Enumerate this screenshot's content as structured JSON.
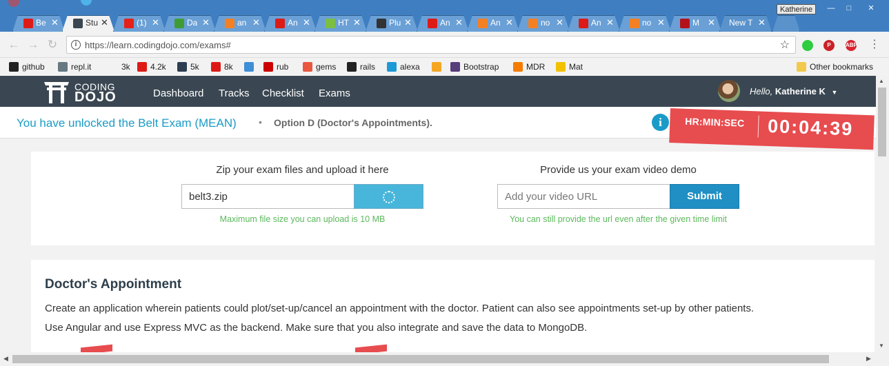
{
  "window": {
    "user": "Katherine",
    "tabs": [
      {
        "label": "Be",
        "icon": "angular-icon",
        "color": "#dd1b16"
      },
      {
        "label": "Stu",
        "icon": "codingdojo-icon",
        "color": "#3a4752"
      },
      {
        "label": "(1)",
        "icon": "youtube-icon",
        "color": "#e62117"
      },
      {
        "label": "Da",
        "icon": "mongodb-icon",
        "color": "#3f9c35"
      },
      {
        "label": "an",
        "icon": "stackoverflow-icon",
        "color": "#f48024"
      },
      {
        "label": "An",
        "icon": "angular-icon",
        "color": "#dd1b16"
      },
      {
        "label": "HT",
        "icon": "chart-icon",
        "color": "#7bbf42"
      },
      {
        "label": "Plu",
        "icon": "plunker-icon",
        "color": "#333333"
      },
      {
        "label": "An",
        "icon": "angular-icon",
        "color": "#dd1b16"
      },
      {
        "label": "An",
        "icon": "stackoverflow-icon",
        "color": "#f48024"
      },
      {
        "label": "no",
        "icon": "stackoverflow-icon",
        "color": "#f48024"
      },
      {
        "label": "An",
        "icon": "angular-icon",
        "color": "#dd1b16"
      },
      {
        "label": "no",
        "icon": "stackoverflow-icon",
        "color": "#f48024"
      },
      {
        "label": "M",
        "icon": "mdn-icon",
        "color": "#b4121a"
      },
      {
        "label": "New T",
        "icon": "",
        "color": ""
      }
    ]
  },
  "toolbar": {
    "url": "https://learn.codingdojo.com/exams#",
    "extensions": [
      {
        "name": "green-dot-icon",
        "color": "#2ecc40",
        "text": ""
      },
      {
        "name": "pinterest-icon",
        "color": "#cb2027",
        "text": "P"
      },
      {
        "name": "adblock-icon",
        "color": "#d9232d",
        "text": "ABP"
      }
    ]
  },
  "bookmarks": {
    "items": [
      {
        "label": "github",
        "icon": "github-icon",
        "color": "#222222"
      },
      {
        "label": "repl.it",
        "icon": "replit-icon",
        "color": "#667881"
      },
      {
        "label": "3k",
        "icon": "blank-icon",
        "color": "#f2f2f2"
      },
      {
        "label": "4.2k",
        "icon": "angular-icon",
        "color": "#dd1b16"
      },
      {
        "label": "5k",
        "icon": "terminal-icon",
        "color": "#2c3e50"
      },
      {
        "label": "8k",
        "icon": "angular-icon",
        "color": "#dd1b16"
      },
      {
        "label": "",
        "icon": "shapes-icon",
        "color": "#3d8fd6"
      },
      {
        "label": "rub",
        "icon": "ruby-icon",
        "color": "#cc0000"
      },
      {
        "label": "gems",
        "icon": "gem-icon",
        "color": "#e9573f"
      },
      {
        "label": "rails",
        "icon": "github-icon",
        "color": "#222222"
      },
      {
        "label": "alexa",
        "icon": "mic-icon",
        "color": "#1c9ad6"
      },
      {
        "label": "",
        "icon": "sun-icon",
        "color": "#f5a623"
      },
      {
        "label": "Bootstrap",
        "icon": "bootstrap-icon",
        "color": "#563d7c"
      },
      {
        "label": "MDR",
        "icon": "chevron-icon",
        "color": "#f57c00"
      },
      {
        "label": "Mat",
        "icon": "flag-icon",
        "color": "#f2c200"
      }
    ],
    "other": "Other bookmarks"
  },
  "site": {
    "logo_line1": "CODING",
    "logo_line2": "DOJO",
    "nav": [
      "Dashboard",
      "Tracks",
      "Checklist",
      "Exams"
    ],
    "greeting_hello": "Hello,",
    "greeting_name": "Katherine K"
  },
  "exam": {
    "unlocked": "You have unlocked the Belt Exam (MEAN)",
    "separator": "•",
    "option": "Option D (Doctor's Appointments).",
    "timer_label": "HR:MIN:SEC",
    "timer_value": "00:04:39"
  },
  "upload": {
    "zip_heading": "Zip your exam files and upload it here",
    "zip_value": "belt3.zip",
    "zip_hint": "Maximum file size you can upload is 10 MB",
    "video_heading": "Provide us your exam video demo",
    "video_placeholder": "Add your video URL",
    "submit": "Submit",
    "video_hint": "You can still provide the url even after the given time limit"
  },
  "description": {
    "title": "Doctor's Appointment",
    "line1": "Create an application wherein patients could plot/set-up/cancel an appointment with the doctor. Patient can also see appointments set-up by other patients.",
    "line2": "Use Angular and use Express MVC as the backend. Make sure that you also integrate and save the data to MongoDB."
  }
}
